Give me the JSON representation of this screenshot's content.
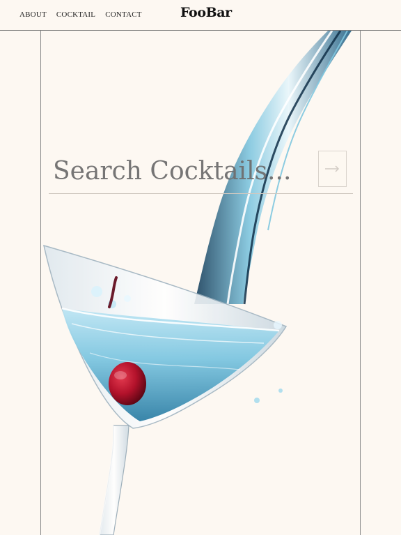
{
  "header": {
    "nav": [
      {
        "label": "ABOUT"
      },
      {
        "label": "COCKTAIL"
      },
      {
        "label": "CONTACT"
      }
    ],
    "brand": "FooBar"
  },
  "search": {
    "placeholder": "Search Cocktails...",
    "submit_icon": "arrow-right-icon"
  },
  "hero": {
    "subject": "martini-glass-pour-image"
  },
  "colors": {
    "background": "#fdf8f2",
    "liquid": "#4aa7c7",
    "cherry": "#b3122b",
    "divider": "#8a8a8a"
  }
}
